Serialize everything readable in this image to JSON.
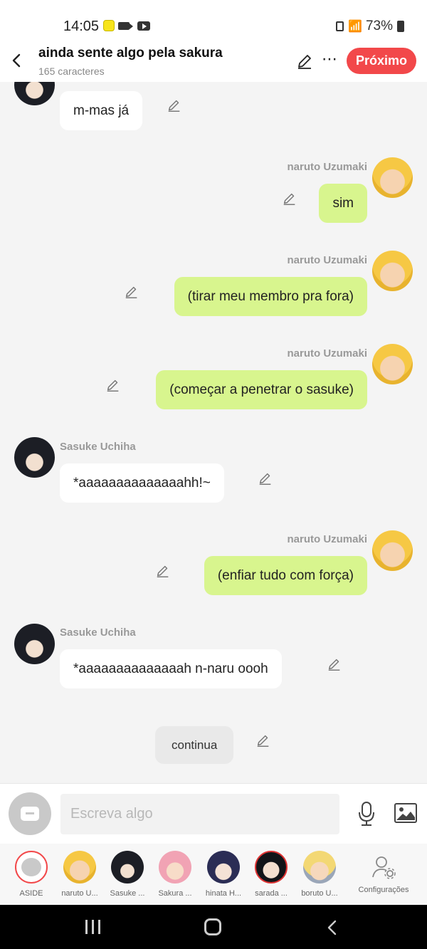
{
  "status_bar": {
    "time": "14:05",
    "battery": "73%"
  },
  "header": {
    "title": "ainda sente algo pela sakura",
    "subtitle": "165 caracteres",
    "next_label": "Próximo"
  },
  "messages": [
    {
      "side": "left",
      "text": "m-mas já"
    },
    {
      "side": "right",
      "sender": "naruto Uzumaki",
      "text": "sim"
    },
    {
      "side": "right",
      "sender": "naruto Uzumaki",
      "text": "(tirar meu membro pra fora)"
    },
    {
      "side": "right",
      "sender": "naruto Uzumaki",
      "text": "(começar a penetrar o sasuke)"
    },
    {
      "side": "left",
      "sender": "Sasuke Uchiha",
      "text": "*aaaaaaaaaaaaaahh!~"
    },
    {
      "side": "right",
      "sender": "naruto Uzumaki",
      "text": "(enfiar tudo com força)"
    },
    {
      "side": "left",
      "sender": "Sasuke Uchiha",
      "text": "*aaaaaaaaaaaaaah n-naru oooh"
    },
    {
      "side": "center",
      "text": "continua"
    }
  ],
  "composer": {
    "placeholder": "Escreva algo"
  },
  "characters": [
    {
      "label": "ASIDE"
    },
    {
      "label": "naruto U..."
    },
    {
      "label": "Sasuke ..."
    },
    {
      "label": "Sakura ..."
    },
    {
      "label": "hinata H..."
    },
    {
      "label": "sarada ..."
    },
    {
      "label": "boruto U..."
    },
    {
      "label": "Configurações"
    }
  ],
  "colors": {
    "accent": "#f2484a",
    "own_bubble": "#d8f58e",
    "other_bubble": "#ffffff",
    "background": "#f4f4f4"
  }
}
